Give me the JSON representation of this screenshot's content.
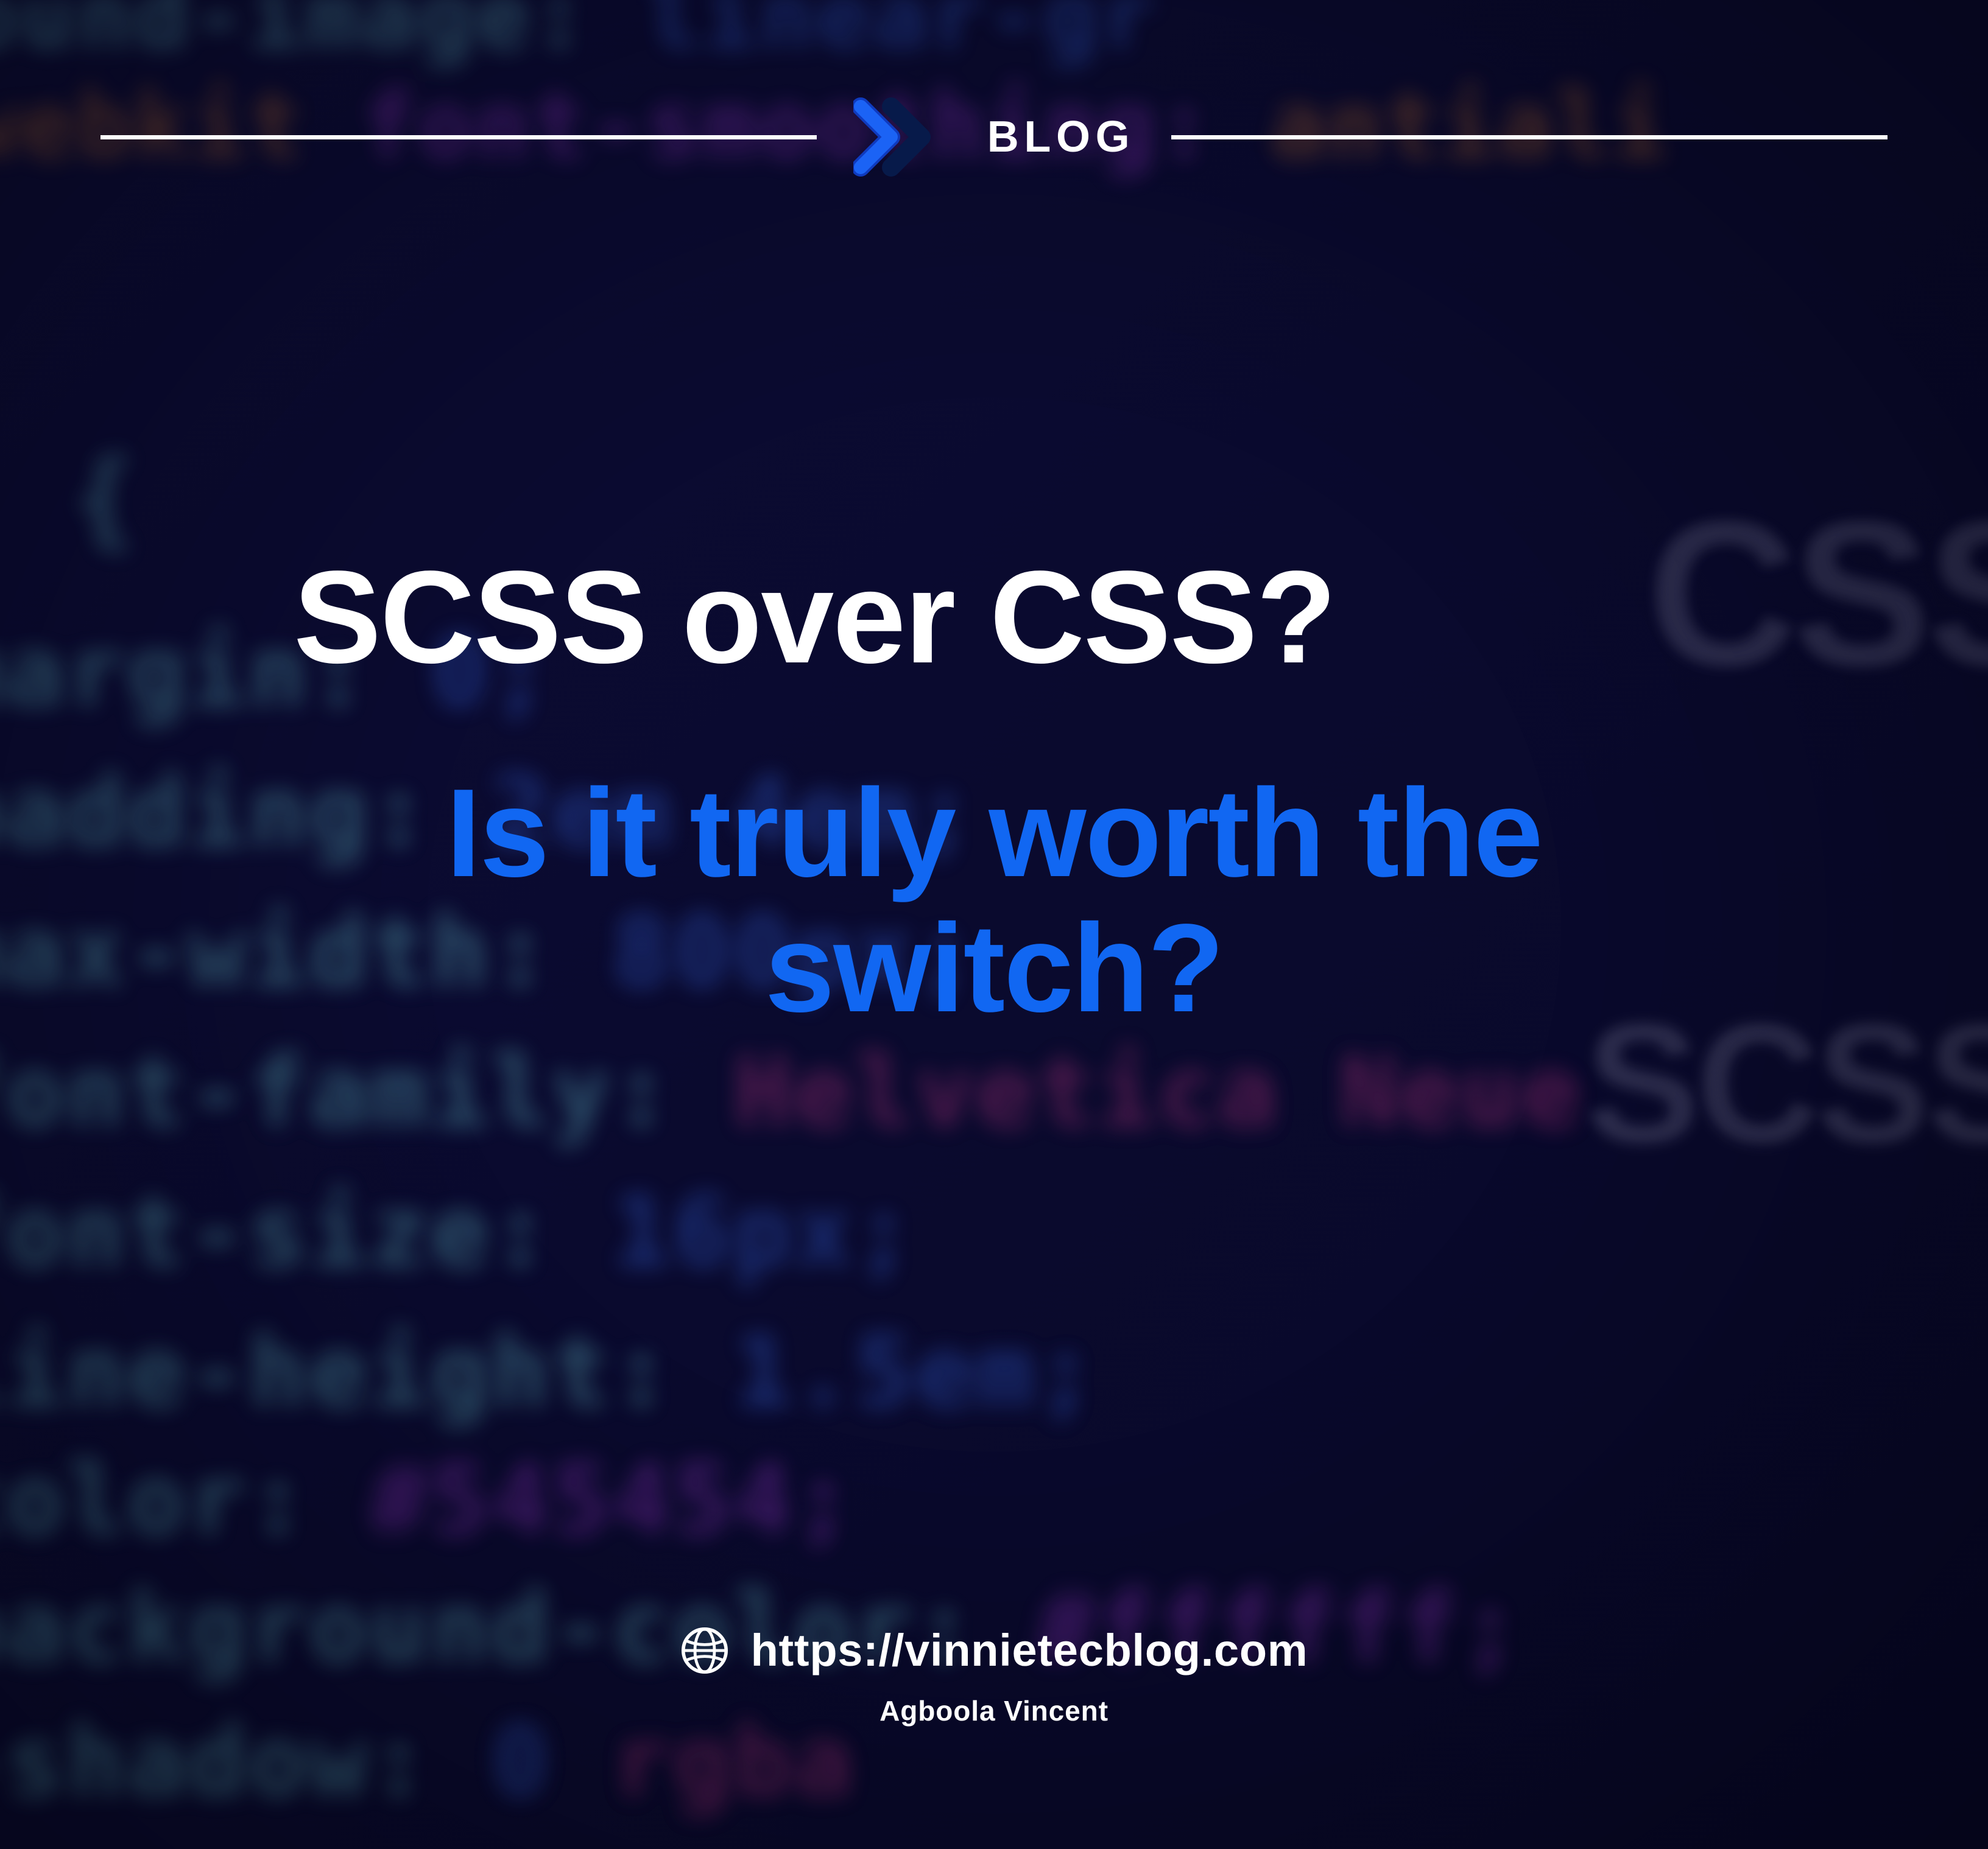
{
  "header": {
    "label": "BLOG"
  },
  "hero": {
    "title": "SCSS over CSS?",
    "subtitle": "Is it truly worth the switch?"
  },
  "footer": {
    "url": "https://vinnietecblog.com",
    "author": "Agboola Vincent"
  },
  "bg": {
    "word_css": "CSS",
    "word_scss": "SCSS",
    "lines": {
      "l0a": "ound-image:",
      "l0b": "linear-gr",
      "l1a": "font-smoothing:",
      "l1b": "antiali",
      "l2": "{",
      "l3a": "margin:",
      "l3b": "0;",
      "l4a": "padding:",
      "l4b": "2em 4em;",
      "l5a": "max-width:",
      "l5b": "800px;",
      "l6a": "font-family:",
      "l6b": "Helvetica Neue",
      "l7a": "font-size:",
      "l7b": "16px;",
      "l8a": "line-height:",
      "l8b": "1.5em;",
      "l9a": "color:",
      "l9b": "#545454;",
      "l10a": "background-color:",
      "l10b": "#ffffff;",
      "l11a": "-shadow:",
      "l11b": "0",
      "l11c": "rgba"
    }
  }
}
